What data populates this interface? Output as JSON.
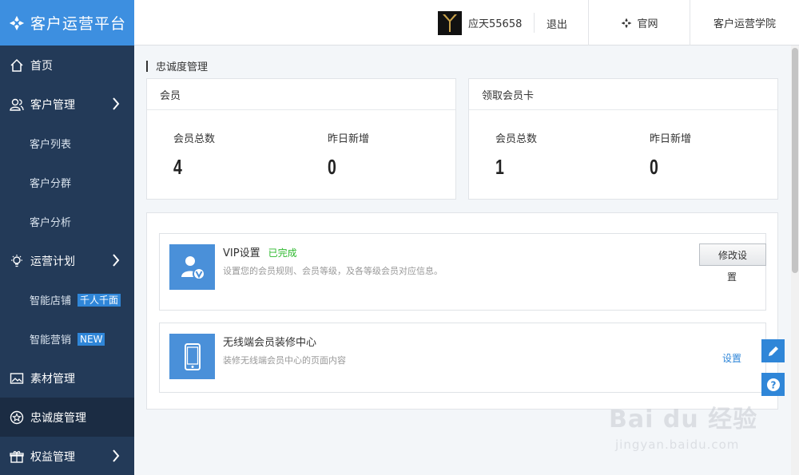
{
  "brand": {
    "title": "客户运营平台"
  },
  "header": {
    "username": "应天55658",
    "logout": "退出",
    "official_site": "官网",
    "academy": "客户运营学院"
  },
  "sidebar": {
    "items": [
      {
        "label": "首页",
        "icon": "home-icon"
      },
      {
        "label": "客户管理",
        "icon": "users-icon"
      },
      {
        "label": "客户列表"
      },
      {
        "label": "客户分群"
      },
      {
        "label": "客户分析"
      },
      {
        "label": "运营计划",
        "icon": "bulb-icon"
      },
      {
        "label": "智能店铺",
        "badge": "千人千面"
      },
      {
        "label": "智能营销",
        "badge": "NEW"
      },
      {
        "label": "素材管理",
        "icon": "image-icon"
      },
      {
        "label": "忠诚度管理",
        "icon": "star-circle-icon"
      },
      {
        "label": "权益管理",
        "icon": "gift-icon"
      }
    ]
  },
  "main": {
    "page_title": "忠诚度管理",
    "member_card": {
      "title": "会员",
      "total_label": "会员总数",
      "total_value": "4",
      "new_label": "昨日新增",
      "new_value": "0"
    },
    "claim_card": {
      "title": "领取会员卡",
      "total_label": "会员总数",
      "total_value": "1",
      "new_label": "昨日新增",
      "new_value": "0"
    },
    "vip": {
      "title": "VIP设置",
      "status": "已完成",
      "desc": "设置您的会员规则、会员等级，及各等级会员对应信息。",
      "button": "修改设",
      "button_wrap": "置"
    },
    "mobile": {
      "title": "无线端会员装修中心",
      "desc": "装修无线端会员中心的页面内容",
      "link": "设置"
    }
  },
  "watermark": {
    "main": "Bai du 经验",
    "sub": "jingyan.baidu.com"
  },
  "colors": {
    "brand": "#3d8fe0",
    "sidebar": "#233a58",
    "accent": "#2f86d8",
    "done": "#2db82d"
  }
}
